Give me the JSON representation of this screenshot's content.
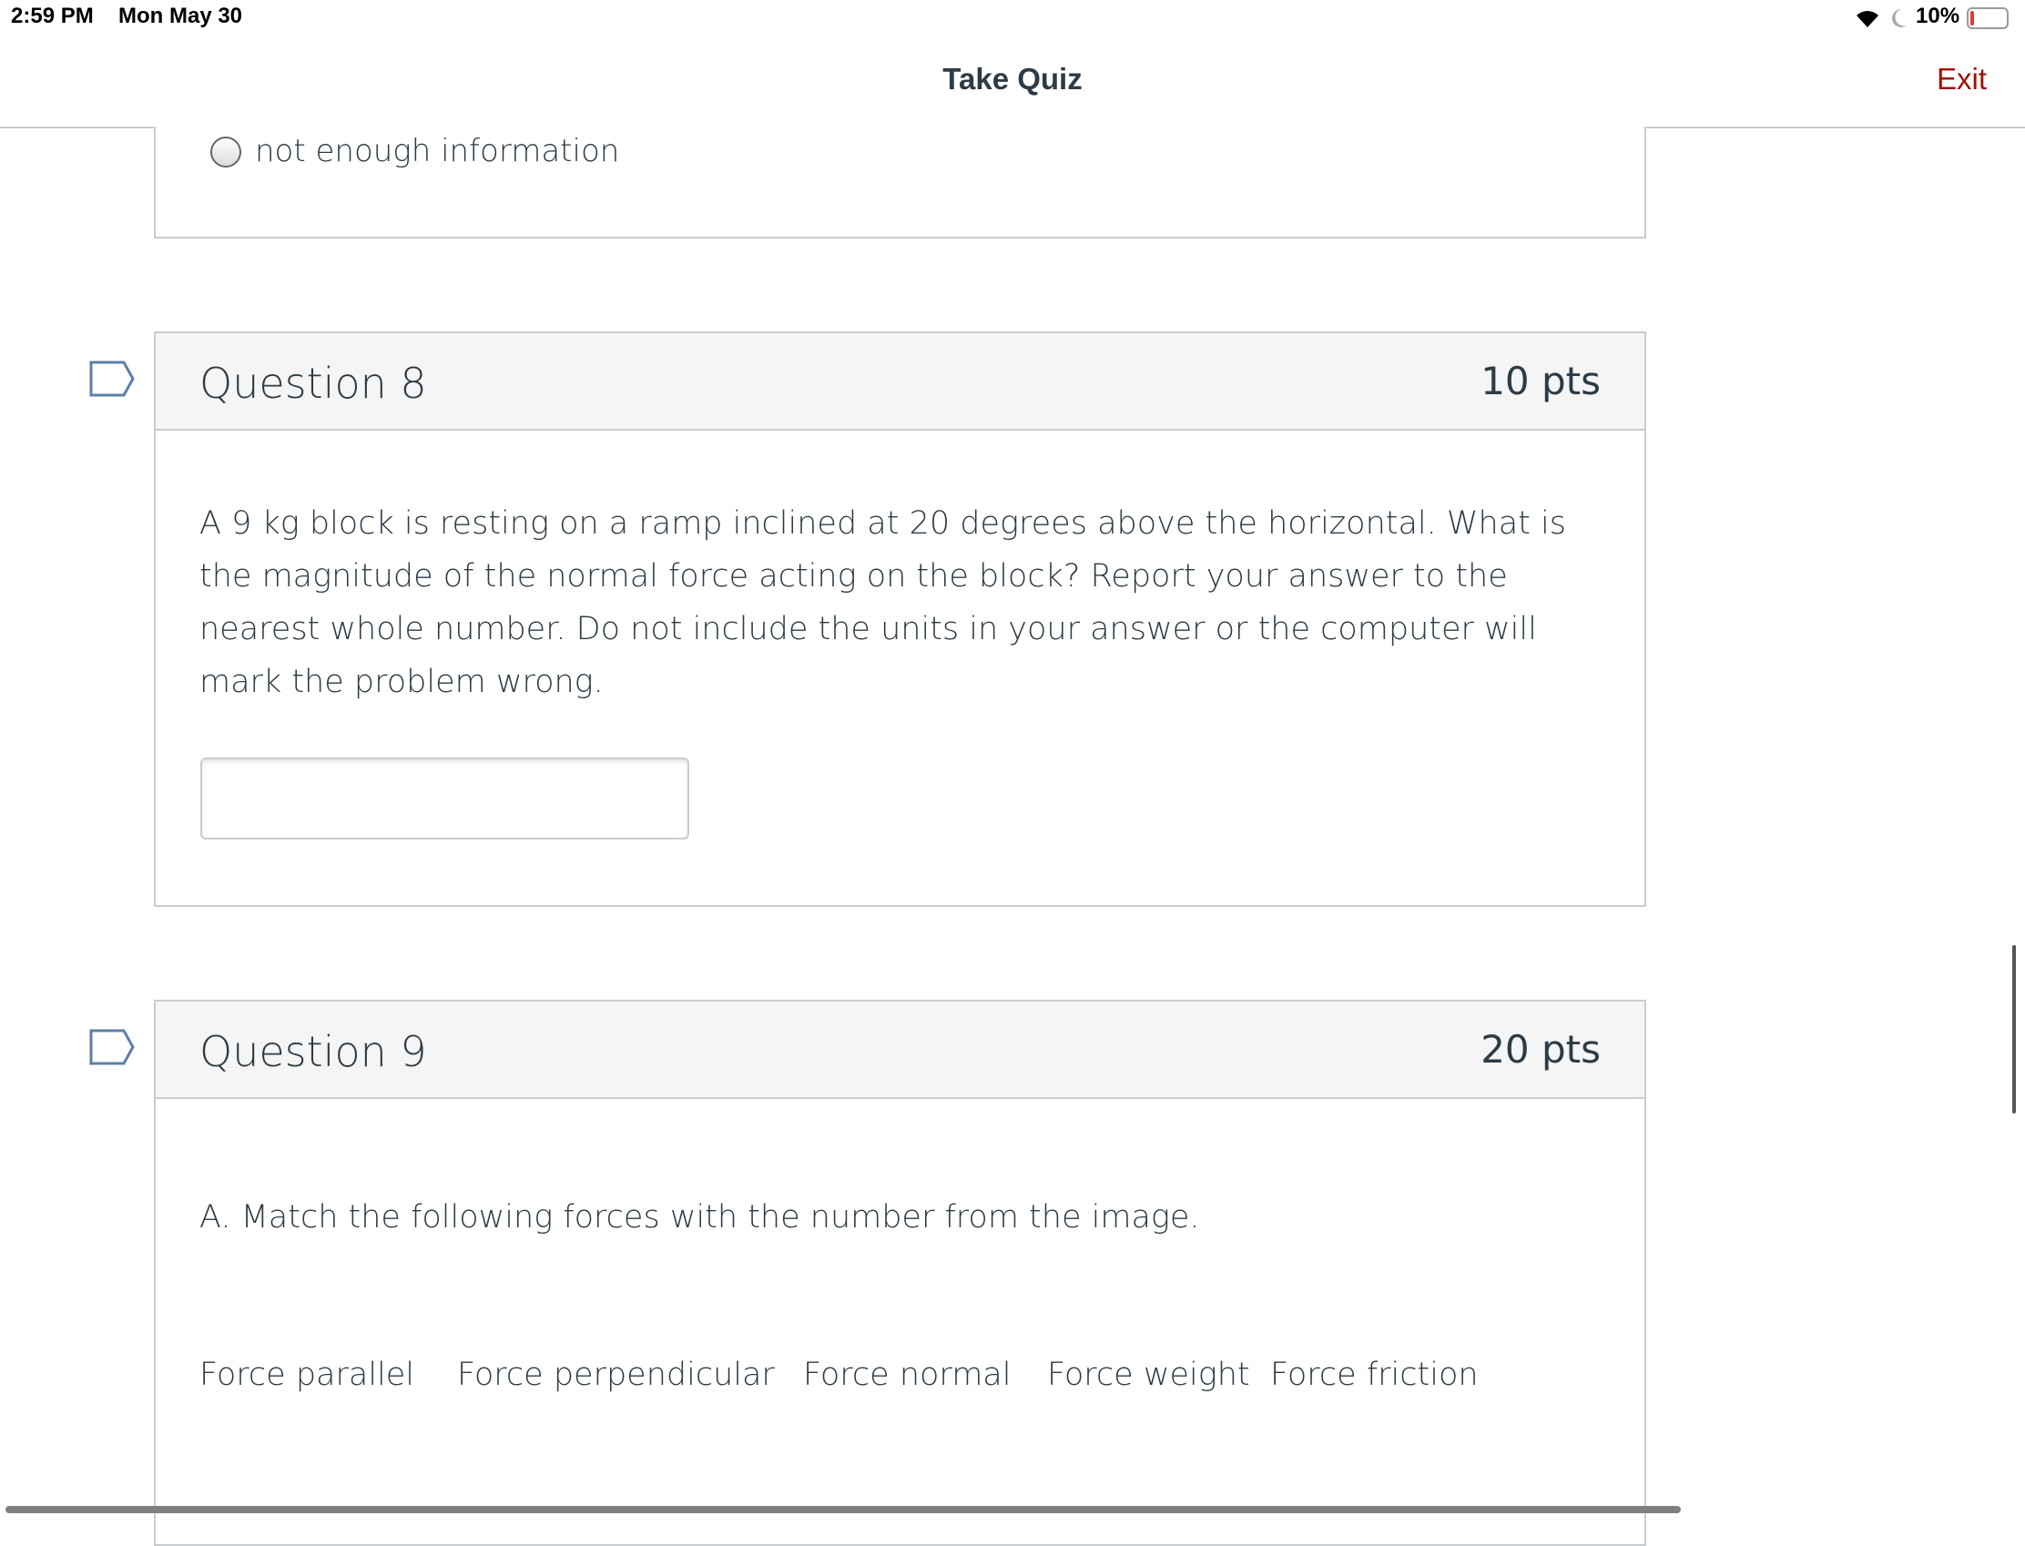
{
  "status_bar": {
    "time": "2:59 PM",
    "date": "Mon May 30",
    "battery": "10%",
    "battery_level": 0.1,
    "icons": [
      "wifi-icon",
      "moon-icon",
      "battery-icon"
    ]
  },
  "header": {
    "title": "Take Quiz",
    "exit_label": "Exit",
    "exit_color": "#a0120c"
  },
  "prev_question": {
    "option": "not enough information"
  },
  "questions": [
    {
      "title": "Question 8",
      "points": "10 pts",
      "text": "A 9 kg block is resting on a ramp inclined at 20 degrees above the horizontal. What is the magnitude of the normal force acting on the block? Report your answer to the nearest whole number. Do not include the units in your answer or the computer will mark the problem wrong.",
      "answer": ""
    },
    {
      "title": "Question 9",
      "points": "20 pts",
      "text": "A. Match the following forces with the number from the image.",
      "forces": [
        "Force parallel",
        "Force perpendicular",
        "Force normal",
        "Force weight",
        "Force friction"
      ]
    }
  ]
}
